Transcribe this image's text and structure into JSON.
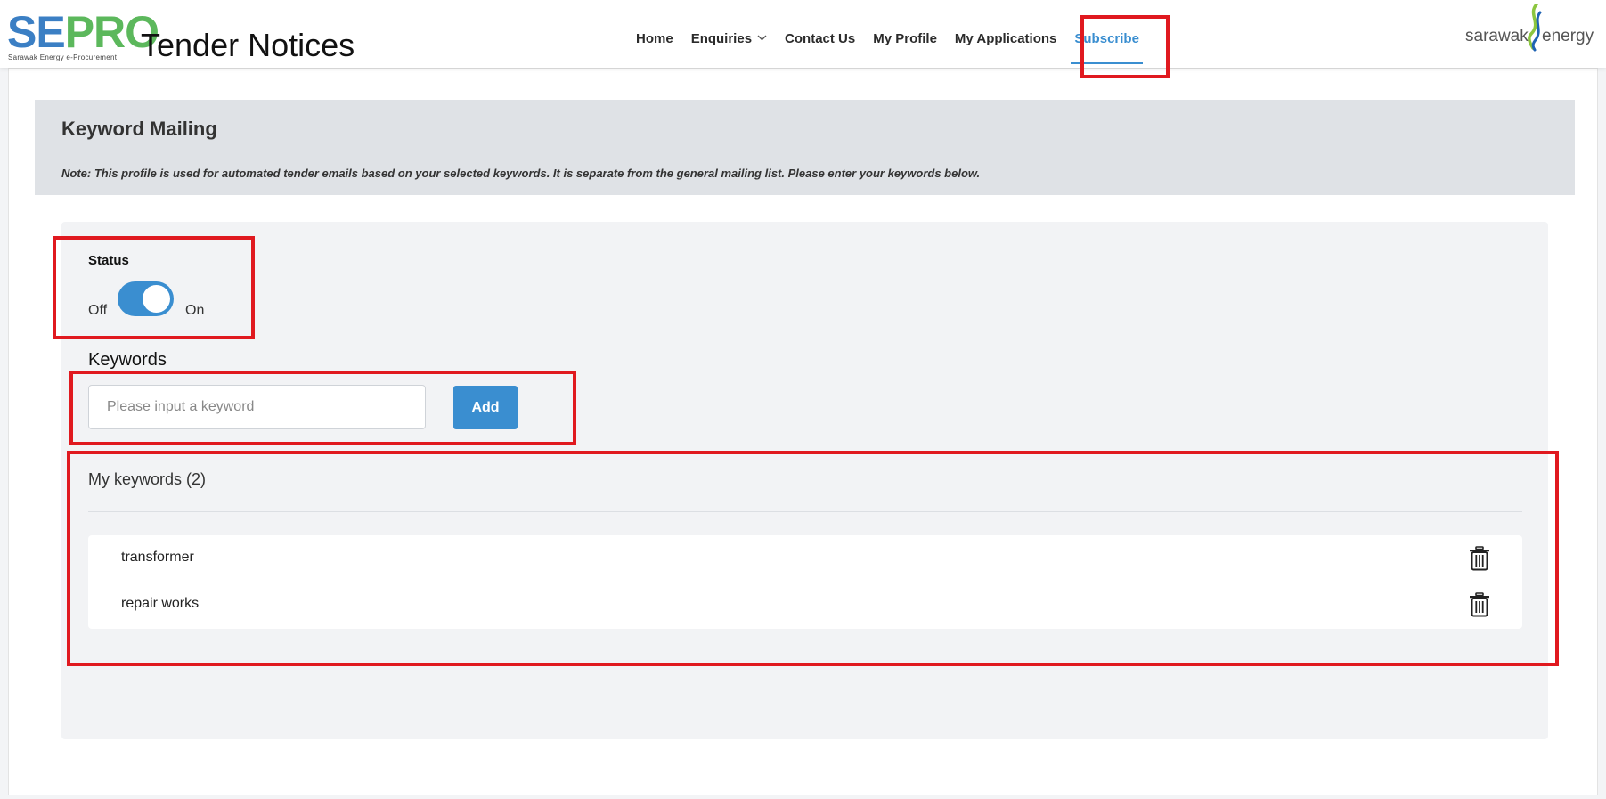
{
  "header": {
    "logo_se": "SE",
    "logo_pro": "PRO",
    "logo_subtitle": "Sarawak Energy e-Procurement",
    "app_title": "Tender Notices",
    "nav": [
      {
        "label": "Home"
      },
      {
        "label": "Enquiries"
      },
      {
        "label": "Contact Us"
      },
      {
        "label": "My Profile"
      },
      {
        "label": "My Applications"
      },
      {
        "label": "Subscribe",
        "active": true
      }
    ],
    "partner_logo_left": "sarawak",
    "partner_logo_right": "energy"
  },
  "page": {
    "title": "Keyword Mailing",
    "note": "Note: This profile is used for automated tender emails based on your selected keywords. It is separate from the general mailing list. Please enter your keywords below."
  },
  "status": {
    "label": "Status",
    "off_label": "Off",
    "on_label": "On",
    "value": "On"
  },
  "keywords": {
    "heading": "Keywords",
    "input_value": "",
    "input_placeholder": "Please input a keyword",
    "add_label": "Add",
    "my_keywords_heading": "My keywords (2)",
    "items": [
      "transformer",
      "repair works"
    ]
  },
  "colors": {
    "accent": "#3a8ed0",
    "logo_blue": "#3b7fc4",
    "logo_green": "#5cb85c",
    "highlight": "#e0191f"
  },
  "icons": [
    "chevron-down-icon",
    "trash-icon",
    "sarawak-energy-swoosh-icon"
  ]
}
